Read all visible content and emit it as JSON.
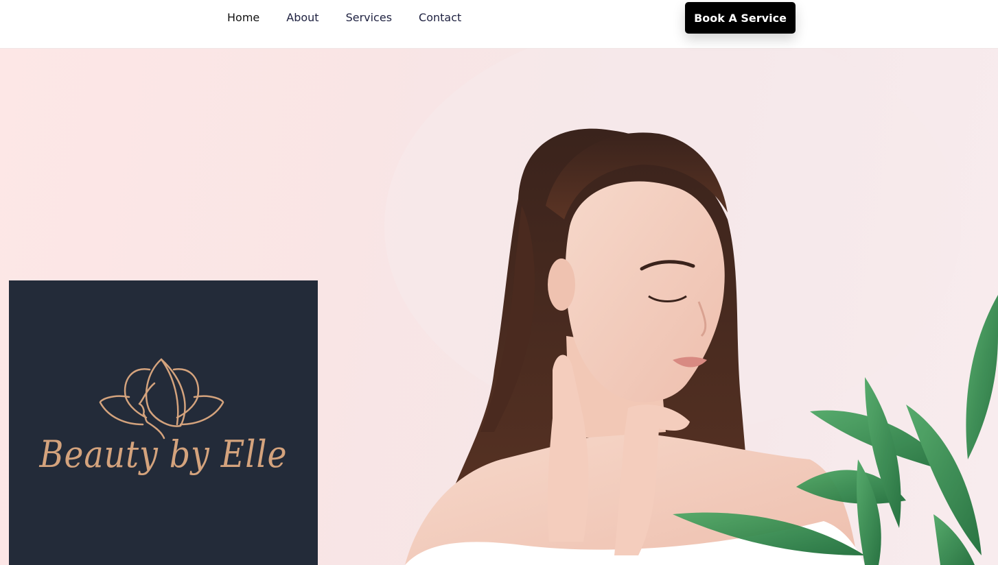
{
  "nav": {
    "items": [
      {
        "label": "Home"
      },
      {
        "label": "About"
      },
      {
        "label": "Services"
      },
      {
        "label": "Contact"
      }
    ],
    "cta_label": "Book A Service"
  },
  "logo": {
    "text": "Beauty by Elle",
    "icon": "lotus-face-icon",
    "background_color": "#232b39",
    "accent_color": "#d4a37d"
  },
  "hero": {
    "background_color": "#fde7e6",
    "image": "woman-portrait-with-plant-image"
  },
  "colors": {
    "cta_background": "#000000",
    "nav_text": "#1e2140"
  }
}
